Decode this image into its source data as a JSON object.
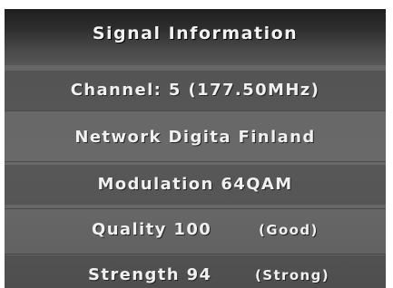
{
  "dialog": {
    "title": "Signal Information",
    "channel": "Channel: 5 (177.50MHz)",
    "network": "Network Digita Finland",
    "modulation": "Modulation 64QAM",
    "quality": {
      "label": "Quality 100",
      "status": "(Good)"
    },
    "strength": {
      "label": "Strength 94",
      "status": "(Strong)"
    }
  }
}
